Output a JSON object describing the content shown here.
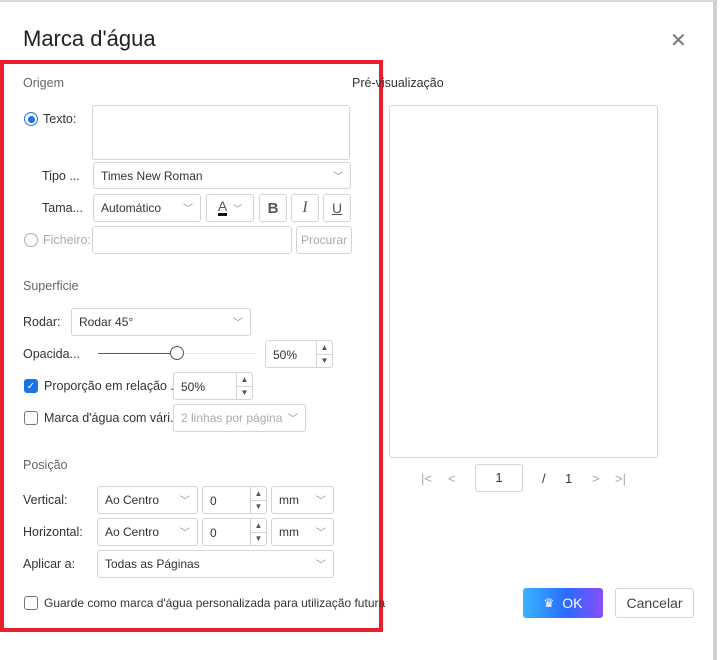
{
  "dialog": {
    "title": "Marca d'água",
    "close_icon": "close-icon"
  },
  "origem": {
    "heading": "Origem",
    "texto_label": "Texto:",
    "texto_value": "",
    "tipo_label": "Tipo ...",
    "font": "Times New Roman",
    "tamanho_label": "Tama...",
    "size": "Automático",
    "color_letter": "A",
    "bold": "B",
    "italic": "I",
    "underline": "U",
    "ficheiro_label": "Ficheiro:",
    "ficheiro_value": "",
    "procurar": "Procurar"
  },
  "superficie": {
    "heading": "Superficie",
    "rodar_label": "Rodar:",
    "rodar_value": "Rodar 45°",
    "opacidade_label": "Opacida...",
    "opacidade_value": "50%",
    "opacidade_fraction": 0.5,
    "proporcao_label": "Proporção em relação ...",
    "proporcao_checked": true,
    "proporcao_value": "50%",
    "multi_label": "Marca d'água com vári...",
    "multi_checked": false,
    "multi_value": "2 linhas por página"
  },
  "posicao": {
    "heading": "Posição",
    "vertical_label": "Vertical:",
    "vertical_align": "Ao Centro",
    "vertical_value": "0",
    "vertical_unit": "mm",
    "horizontal_label": "Horizontal:",
    "horizontal_align": "Ao Centro",
    "horizontal_value": "0",
    "horizontal_unit": "mm",
    "aplicar_label": "Aplicar a:",
    "aplicar_value": "Todas as Páginas"
  },
  "save_custom": {
    "label": "Guarde como marca d'água personalizada para utilização futura",
    "checked": false
  },
  "preview": {
    "heading": "Pré-visualização",
    "page": "1",
    "separator": "/",
    "total": "1"
  },
  "buttons": {
    "ok": "OK",
    "cancel": "Cancelar"
  },
  "colors": {
    "accent": "#1a73e8",
    "highlight": "#e8202a",
    "ok_gradient_start": "#3ab4ff",
    "ok_gradient_end": "#8a4dff"
  }
}
